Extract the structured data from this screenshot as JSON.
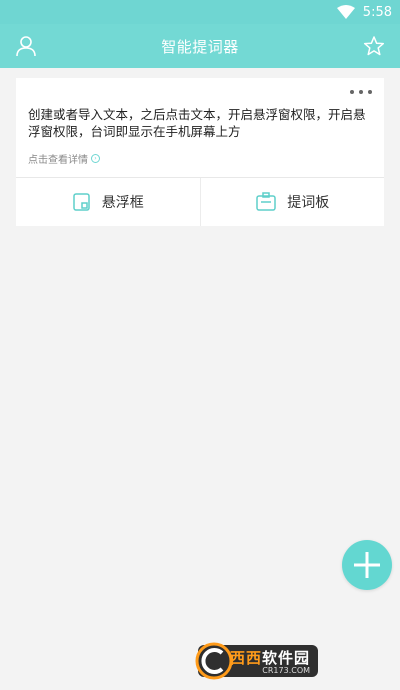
{
  "status": {
    "time": "5:58"
  },
  "header": {
    "title": "智能提词器"
  },
  "card": {
    "description": "创建或者导入文本，之后点击文本，开启悬浮窗权限，开启悬浮窗权限，台词即显示在手机屏幕上方",
    "detail_link": "点击查看详情",
    "actions": [
      {
        "label": "悬浮框"
      },
      {
        "label": "提词板"
      }
    ]
  },
  "fab": {
    "icon": "plus-icon"
  },
  "watermark": {
    "name_part1": "西西",
    "name_part2": "软件园",
    "url": "CR173.COM"
  },
  "colors": {
    "accent": "#73d9d4",
    "fab": "#63d7d1"
  }
}
